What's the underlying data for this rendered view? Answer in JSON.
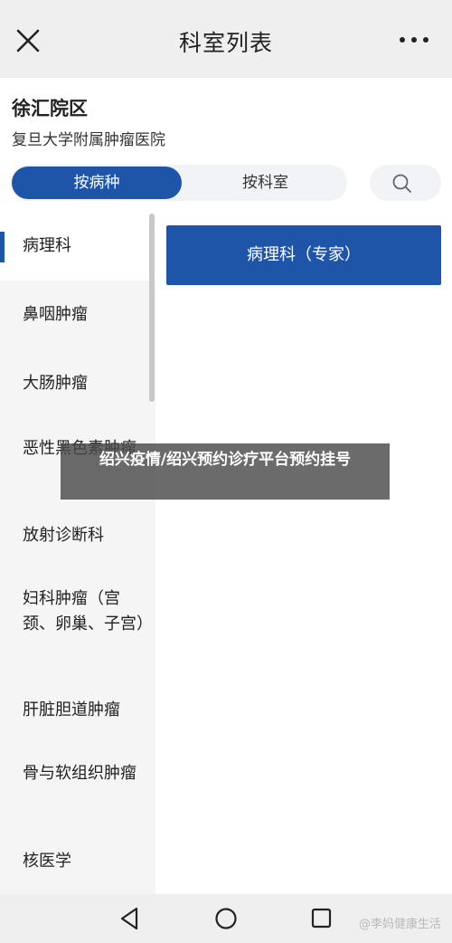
{
  "header": {
    "title": "科室列表",
    "close_icon": "close-icon",
    "more_icon": "more-icon"
  },
  "hospital": {
    "district": "徐汇院区",
    "name": "复旦大学附属肿瘤医院"
  },
  "tabs": {
    "by_disease": "按病种",
    "by_department": "按科室",
    "search_icon": "search-icon"
  },
  "departments": [
    {
      "label": "病理科",
      "active": true
    },
    {
      "label": "鼻咽肿瘤",
      "active": false
    },
    {
      "label": "大肠肿瘤",
      "active": false
    },
    {
      "label": "恶性黑色素肿瘤",
      "active": false
    },
    {
      "label": "放射诊断科",
      "active": false
    },
    {
      "label": "妇科肿瘤（宫颈、卵巢、子宫）",
      "active": false
    },
    {
      "label": "肝脏胆道肿瘤",
      "active": false
    },
    {
      "label": "骨与软组织肿瘤",
      "active": false
    },
    {
      "label": "核医学",
      "active": false
    }
  ],
  "sub_departments": [
    {
      "label": "病理科（专家）"
    }
  ],
  "overlay": {
    "text": "绍兴疫情/绍兴预约诊疗平台预约挂号"
  },
  "navbar": {
    "back_icon": "back-triangle-icon",
    "home_icon": "home-circle-icon",
    "recents_icon": "recents-square-icon",
    "watermark": "@李妈健康生活"
  },
  "colors": {
    "accent": "#1f55a8",
    "sidebar_bg": "#f5f5f6",
    "bar_bg": "#efefef"
  }
}
